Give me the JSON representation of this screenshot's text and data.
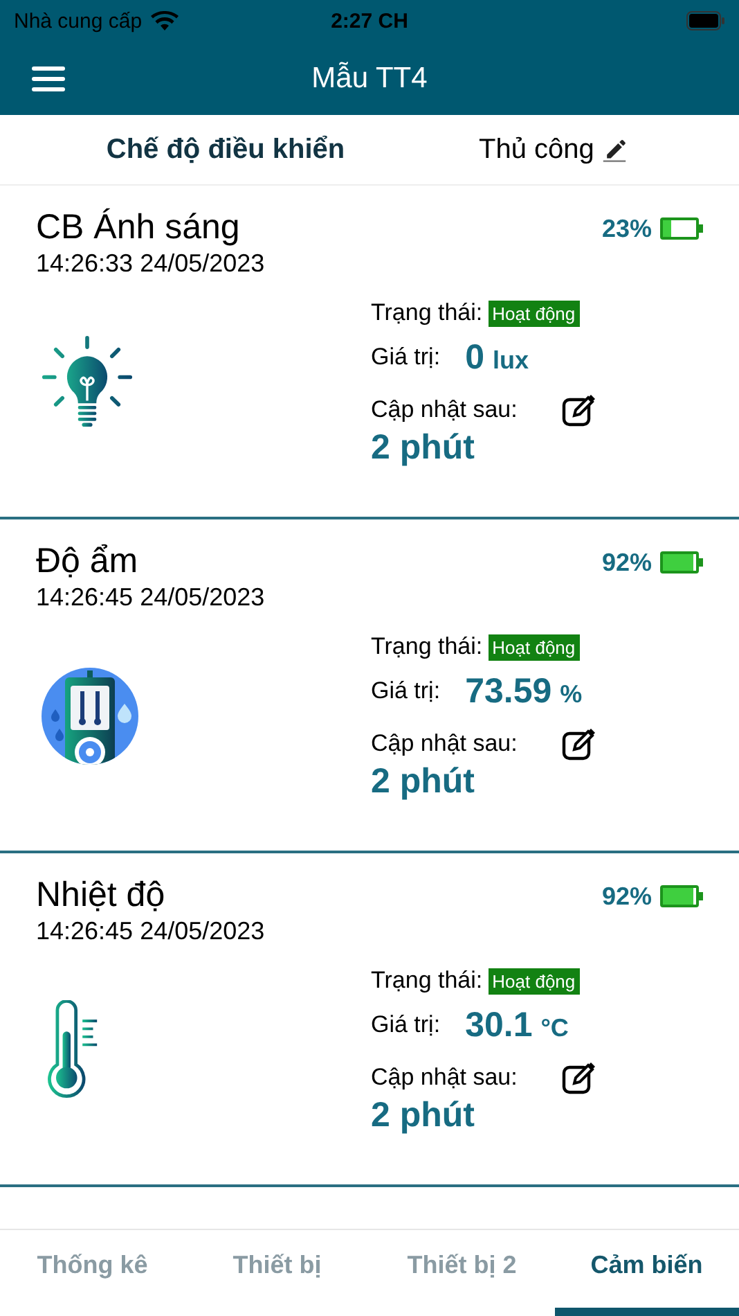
{
  "status_bar": {
    "carrier": "Nhà cung cấp",
    "time": "2:27 CH"
  },
  "header": {
    "title": "Mẫu TT4"
  },
  "mode": {
    "label": "Chế độ điều khiển",
    "value": "Thủ công"
  },
  "sensors": [
    {
      "kind": "light",
      "name": "CB Ánh sáng",
      "timestamp": "14:26:33 24/05/2023",
      "battery": "23%",
      "level": 0.23,
      "status_label": "Trạng thái:",
      "status": "Hoạt động",
      "value_label": "Giá trị:",
      "value": "0",
      "unit": "lux",
      "update_label": "Cập nhật sau:",
      "update": "2 phút"
    },
    {
      "kind": "humidity",
      "name": "Độ ẩm",
      "timestamp": "14:26:45 24/05/2023",
      "battery": "92%",
      "level": 0.92,
      "status_label": "Trạng thái:",
      "status": "Hoạt động",
      "value_label": "Giá trị:",
      "value": "73.59",
      "unit": "%",
      "update_label": "Cập nhật sau:",
      "update": "2 phút"
    },
    {
      "kind": "temperature",
      "name": "Nhiệt độ",
      "timestamp": "14:26:45 24/05/2023",
      "battery": "92%",
      "level": 0.92,
      "status_label": "Trạng thái:",
      "status": "Hoạt động",
      "value_label": "Giá trị:",
      "value": "30.1",
      "unit": "°C",
      "update_label": "Cập nhật sau:",
      "update": "2 phút"
    }
  ],
  "tabs": [
    {
      "label": "Thống kê",
      "selected": false
    },
    {
      "label": "Thiết bị",
      "selected": false
    },
    {
      "label": "Thiết bị 2",
      "selected": false
    },
    {
      "label": "Cảm biến",
      "selected": true
    }
  ]
}
